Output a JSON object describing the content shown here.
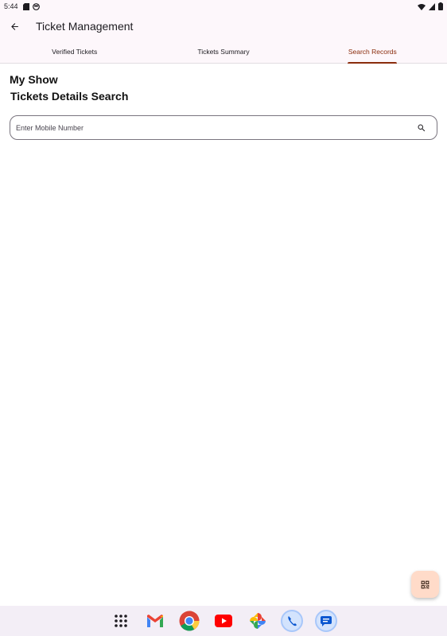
{
  "status_bar": {
    "time": "5:44"
  },
  "app_bar": {
    "title": "Ticket Management"
  },
  "tabs": [
    {
      "label": "Verified Tickets",
      "active": false
    },
    {
      "label": "Tickets Summary",
      "active": false
    },
    {
      "label": "Search Records",
      "active": true
    }
  ],
  "content": {
    "show_title": "My Show",
    "section_title": "Tickets Details Search",
    "search": {
      "placeholder": "Enter Mobile Number",
      "value": ""
    }
  },
  "colors": {
    "accent": "#8a2c0c",
    "fab_bg": "#ffdbc9",
    "surface": "#fdf7fb"
  },
  "dock": [
    {
      "name": "app-drawer-icon"
    },
    {
      "name": "gmail-icon"
    },
    {
      "name": "chrome-icon"
    },
    {
      "name": "youtube-icon"
    },
    {
      "name": "photos-icon"
    },
    {
      "name": "phone-icon"
    },
    {
      "name": "messages-icon"
    }
  ]
}
